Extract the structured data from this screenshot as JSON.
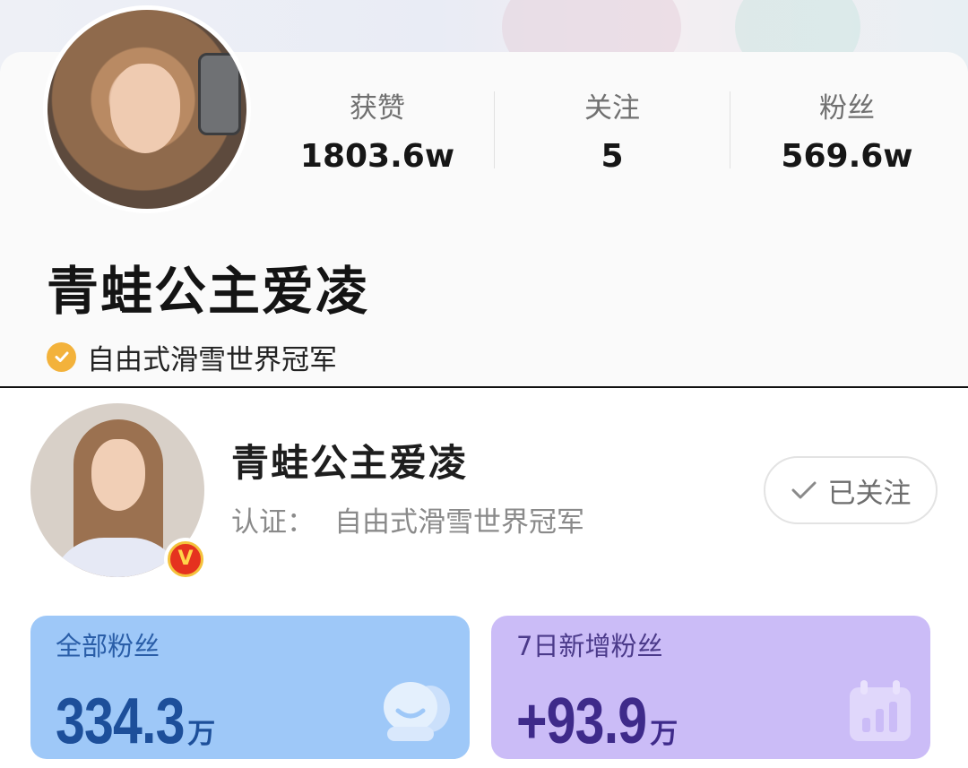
{
  "top_profile": {
    "stats": [
      {
        "label": "获赞",
        "value": "1803.6w"
      },
      {
        "label": "关注",
        "value": "5"
      },
      {
        "label": "粉丝",
        "value": "569.6w"
      }
    ],
    "name": "青蛙公主爱凌",
    "verification": "自由式滑雪世界冠军",
    "verify_icon": "check-circle-icon",
    "verify_color": "#f3b23b"
  },
  "bottom_profile": {
    "name": "青蛙公主爱凌",
    "cert_label": "认证：",
    "cert_value": "自由式滑雪世界冠军",
    "badge_icon": "v-verified-badge-icon",
    "badge_text": "V",
    "follow_button": {
      "label": "已关注",
      "icon": "check-icon"
    },
    "cards": [
      {
        "label": "全部粉丝",
        "value": "334.3",
        "unit": "万",
        "icon": "people-icon",
        "color": "#9ec8f8"
      },
      {
        "label": "7日新增粉丝",
        "value": "+93.9",
        "unit": "万",
        "icon": "bar-chart-icon",
        "color": "#cbbcf7"
      }
    ]
  }
}
